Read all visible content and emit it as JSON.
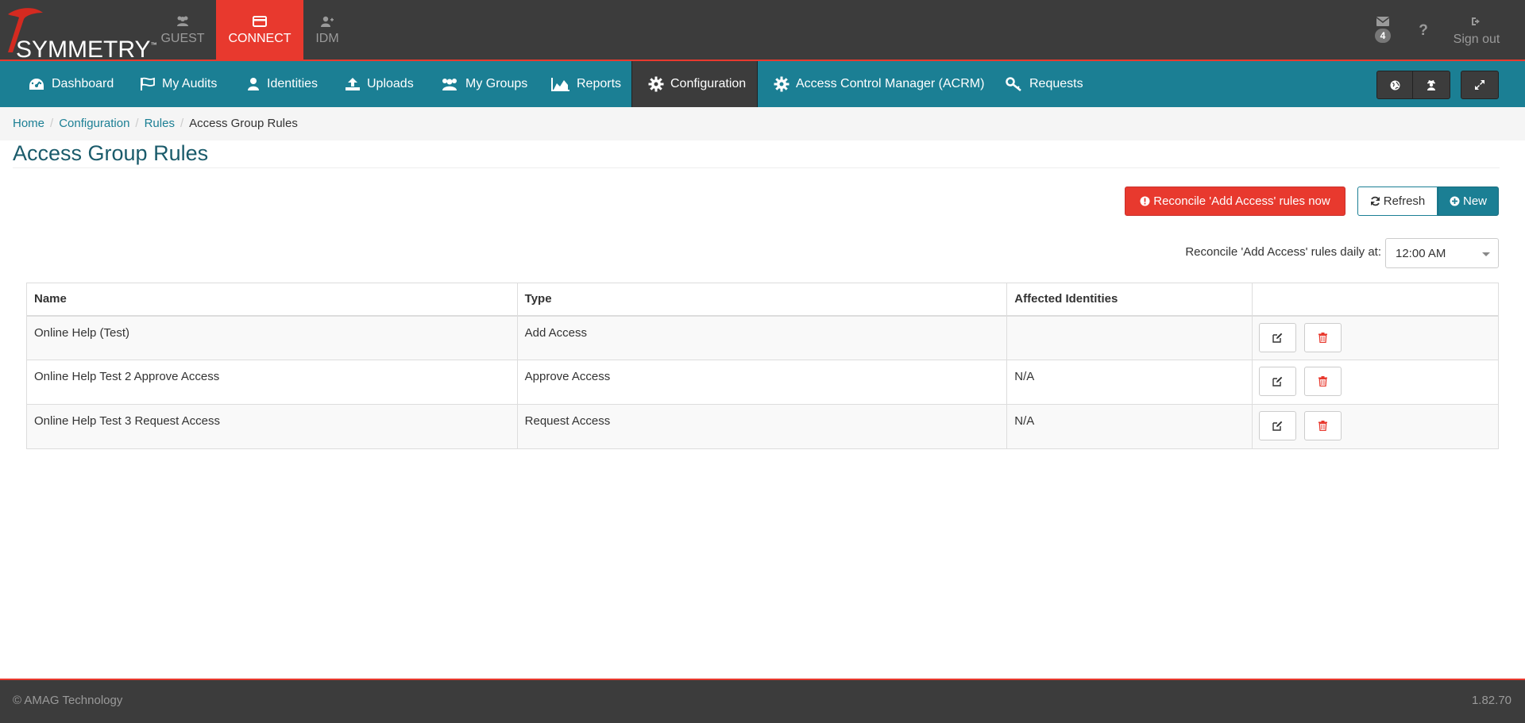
{
  "brand": {
    "name": "SYMMETRY",
    "trademark": "™"
  },
  "app_tabs": [
    {
      "label": "GUEST",
      "icon": "users-icon",
      "active": false
    },
    {
      "label": "CONNECT",
      "icon": "card-icon",
      "active": true
    },
    {
      "label": "IDM",
      "icon": "user-plus-icon",
      "active": false
    }
  ],
  "top_right": {
    "messages_count": "4",
    "sign_out_label": "Sign out"
  },
  "nav": {
    "items": [
      {
        "label": "Dashboard",
        "icon": "dashboard-icon"
      },
      {
        "label": "My Audits",
        "icon": "flag-icon"
      },
      {
        "label": "Identities",
        "icon": "user-icon"
      },
      {
        "label": "Uploads",
        "icon": "upload-icon"
      },
      {
        "label": "My Groups",
        "icon": "group-icon"
      },
      {
        "label": "Reports",
        "icon": "area-chart-icon"
      },
      {
        "label": "Configuration",
        "icon": "gear-icon",
        "active": true
      },
      {
        "label": "Access Control Manager (ACRM)",
        "icon": "gear-icon"
      },
      {
        "label": "Requests",
        "icon": "key-icon"
      }
    ]
  },
  "breadcrumb": {
    "items": [
      "Home",
      "Configuration",
      "Rules"
    ],
    "current": "Access Group Rules"
  },
  "page": {
    "title": "Access Group Rules",
    "reconcile_button": "Reconcile 'Add Access' rules now",
    "refresh_button": "Refresh",
    "new_button": "New",
    "daily_label": "Reconcile 'Add Access' rules daily at:",
    "daily_time": "12:00 AM"
  },
  "table": {
    "headers": [
      "Name",
      "Type",
      "Affected Identities",
      ""
    ],
    "rows": [
      {
        "name": "Online Help (Test)",
        "type": "Add Access",
        "affected": ""
      },
      {
        "name": "Online Help Test 2 Approve Access",
        "type": "Approve Access",
        "affected": "N/A"
      },
      {
        "name": "Online Help Test 3 Request Access",
        "type": "Request Access",
        "affected": "N/A"
      }
    ]
  },
  "footer": {
    "copyright": "© AMAG Technology",
    "version": "1.82.70"
  },
  "colors": {
    "brand_red": "#e8392e",
    "nav_teal": "#1b7f94",
    "dark_bar": "#3c3c3c"
  }
}
